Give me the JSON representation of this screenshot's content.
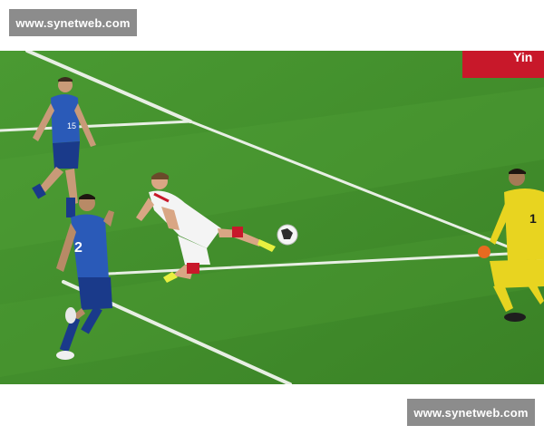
{
  "watermark_top": {
    "text": "www.synetweb.com"
  },
  "photo": {
    "subject": "soccer-match-scene",
    "colors": {
      "pitch": "#3f8a2a",
      "pitch_stripe": "#4a9a32",
      "line": "#e8efe4",
      "blue_kit": "#2a5ab8",
      "white_kit": "#f4f4f4",
      "goalkeeper_kit": "#e8d420",
      "board": "#c8182a"
    },
    "players": [
      {
        "role": "defender-blue",
        "shirt_number": "15"
      },
      {
        "role": "defender-blue",
        "shirt_number": "2"
      },
      {
        "role": "striker-white"
      },
      {
        "role": "goalkeeper-yellow",
        "shirt_number": "1"
      }
    ],
    "board_text": "Yin"
  },
  "watermark_bottom": {
    "text": "www.synetweb.com"
  }
}
